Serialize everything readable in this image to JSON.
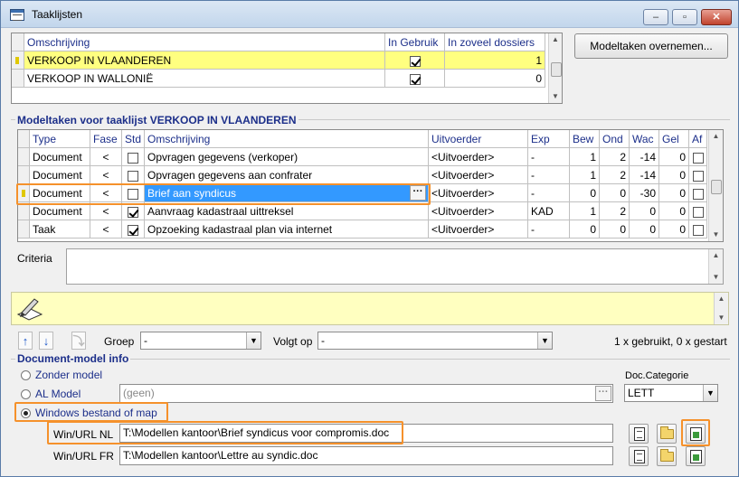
{
  "window": {
    "title": "Taaklijsten",
    "min": "–",
    "max": "▫",
    "close": "✕"
  },
  "tasklists": {
    "headers": [
      "Omschrijving",
      "In Gebruik",
      "In zoveel dossiers"
    ],
    "rows": [
      {
        "name": "VERKOOP IN VLAANDEREN",
        "in_use": true,
        "dossiers": "1",
        "selected": true
      },
      {
        "name": "VERKOOP IN WALLONIË",
        "in_use": true,
        "dossiers": "0",
        "selected": false
      }
    ]
  },
  "buttons": {
    "take_over": "Modeltaken overnemen..."
  },
  "modeltaken": {
    "title": "Modeltaken voor taaklijst VERKOOP IN VLAANDEREN",
    "headers": [
      "Type",
      "Fase",
      "Std",
      "Omschrijving",
      "Uitvoerder",
      "Exp",
      "Bew",
      "Ond",
      "Wac",
      "Gel",
      "Af"
    ],
    "rows": [
      {
        "type": "Document",
        "fase": "<",
        "std": false,
        "omschrijving": "Opvragen gegevens (verkoper)",
        "uitvoerder": "<Uitvoerder>",
        "exp": "-",
        "bew": "1",
        "ond": "2",
        "wac": "-14",
        "gel": "0",
        "af": false
      },
      {
        "type": "Document",
        "fase": "<",
        "std": false,
        "omschrijving": "Opvragen gegevens aan confrater",
        "uitvoerder": "<Uitvoerder>",
        "exp": "-",
        "bew": "1",
        "ond": "2",
        "wac": "-14",
        "gel": "0",
        "af": false
      },
      {
        "type": "Document",
        "fase": "<",
        "std": false,
        "omschrijving": "Brief aan syndicus",
        "uitvoerder": "<Uitvoerder>",
        "exp": "-",
        "bew": "0",
        "ond": "0",
        "wac": "-30",
        "gel": "0",
        "af": false
      },
      {
        "type": "Document",
        "fase": "<",
        "std": true,
        "omschrijving": "Aanvraag kadastraal uittreksel",
        "uitvoerder": "<Uitvoerder>",
        "exp": "KAD",
        "bew": "1",
        "ond": "2",
        "wac": "0",
        "gel": "0",
        "af": false
      },
      {
        "type": "Taak",
        "fase": "<",
        "std": true,
        "omschrijving": "Opzoeking kadastraal plan via internet",
        "uitvoerder": "<Uitvoerder>",
        "exp": "-",
        "bew": "0",
        "ond": "0",
        "wac": "0",
        "gel": "0",
        "af": false
      }
    ],
    "ellipsis": "···"
  },
  "criteria": {
    "label": "Criteria",
    "value": ""
  },
  "nav": {
    "up": "↑",
    "down": "↓",
    "groep_label": "Groep",
    "groep_value": "-",
    "volgt_op_label": "Volgt op",
    "volgt_op_value": "-",
    "usage": "1 x gebruikt, 0 x gestart"
  },
  "docinfo": {
    "title": "Document-model info",
    "zonder_model": "Zonder model",
    "al_model": "AL Model",
    "al_model_value": "(geen)",
    "windows": "Windows bestand of map",
    "selected": "windows",
    "doc_categorie_label": "Doc.Categorie",
    "doc_categorie_value": "LETT",
    "url_nl_label": "Win/URL NL",
    "url_nl_value": "T:\\Modellen kantoor\\Brief syndicus voor compromis.doc",
    "url_fr_label": "Win/URL FR",
    "url_fr_value": "T:\\Modellen kantoor\\Lettre au syndic.doc",
    "ellipsis": "···"
  }
}
